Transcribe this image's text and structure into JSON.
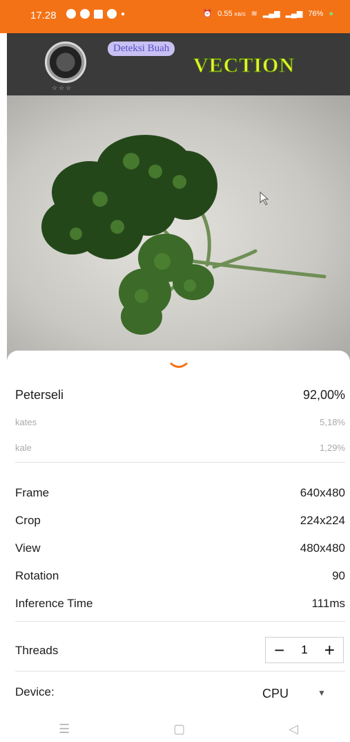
{
  "status_bar": {
    "time": "17.28",
    "network_speed": "0.55",
    "network_unit": "KB/S",
    "battery": "76%"
  },
  "app_bar": {
    "subtitle": "Deteksi Buah",
    "brand": "VECTION",
    "logo_stars": "☆☆☆"
  },
  "camera_view": {
    "subject": "parsley"
  },
  "results": {
    "top": {
      "label": "Peterseli",
      "value": "92,00%"
    },
    "second": {
      "label": "kates",
      "value": "5,18%"
    },
    "third": {
      "label": "kale",
      "value": "1,29%"
    }
  },
  "info": {
    "frame": {
      "label": "Frame",
      "value": "640x480"
    },
    "crop": {
      "label": "Crop",
      "value": "224x224"
    },
    "view": {
      "label": "View",
      "value": "480x480"
    },
    "rotation": {
      "label": "Rotation",
      "value": "90"
    },
    "inference": {
      "label": "Inference Time",
      "value": "111ms"
    }
  },
  "threads": {
    "label": "Threads",
    "value": "1",
    "minus": "−",
    "plus": "+"
  },
  "device": {
    "label": "Device:",
    "value": "CPU"
  },
  "colors": {
    "accent": "#f47216",
    "app_bar": "#3a3a3a",
    "brand": "#e6f12f"
  }
}
